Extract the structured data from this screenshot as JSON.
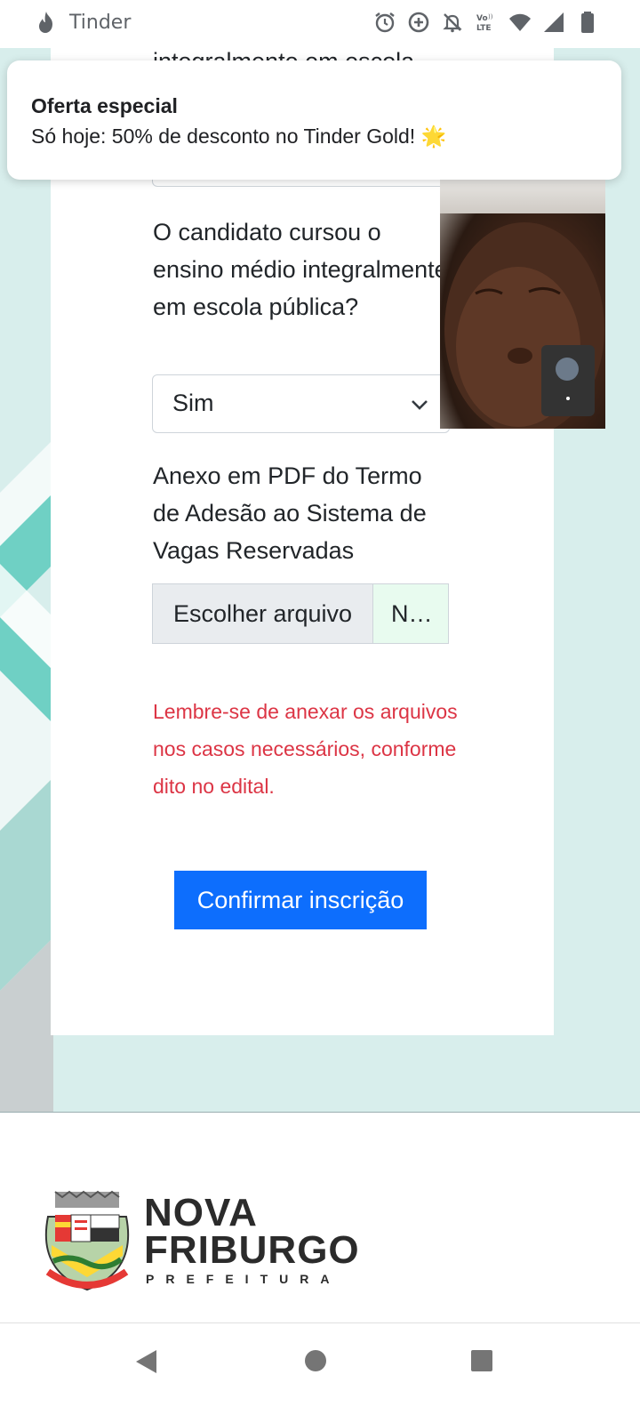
{
  "status_bar": {
    "app_name": "Tinder",
    "icons": [
      "alarm-icon",
      "data-saver-icon",
      "notifications-off-icon",
      "volte-icon",
      "wifi-icon",
      "signal-icon",
      "battery-icon"
    ]
  },
  "notification": {
    "title": "Oferta especial",
    "body": "Só hoje: 50% de desconto no Tinder Gold! 🌟"
  },
  "form": {
    "clipped_text": "integralmente em escola",
    "question": "O candidato cursou o ensino médio integralmente em escola pública?",
    "select_value": "Sim",
    "attachment_label": "Anexo em PDF do Termo de Adesão ao Sistema de Vagas Reservadas",
    "file_button_label": "Escolher arquivo",
    "file_name": "N…",
    "warning": "Lembre-se de anexar os arquivos nos casos necessários, conforme dito no edital.",
    "confirm_label": "Confirmar inscrição"
  },
  "footer": {
    "logo_line1": "NOVA",
    "logo_line2": "FRIBURGO",
    "logo_line3": "PREFEITURA"
  },
  "colors": {
    "page_bg": "#d8eeec",
    "primary": "#0d6efd",
    "danger": "#dc3545",
    "teal_decor": "#6fd0c4"
  },
  "nav_bar": {
    "icons": [
      "back-icon",
      "home-icon",
      "recents-icon"
    ]
  }
}
